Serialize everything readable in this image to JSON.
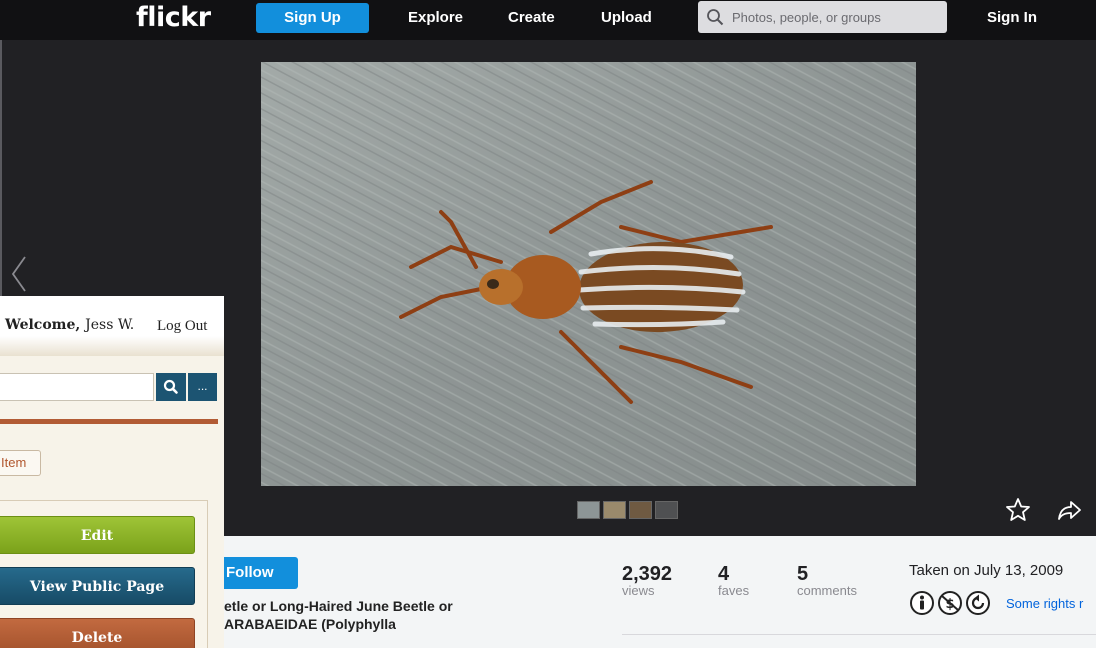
{
  "nav": {
    "logo": "flickr",
    "signup_label": "Sign Up",
    "links": [
      "Explore",
      "Create",
      "Upload"
    ],
    "search_placeholder": "Photos, people, or groups",
    "signin_label": "Sign In"
  },
  "photo": {
    "thumbnail_count": 4,
    "fave_icon": "star-outline-icon",
    "share_icon": "share-arrow-icon"
  },
  "info": {
    "follow_label": "Follow",
    "title_line_1": "etle or Long-Haired June Beetle or",
    "title_line_2": "ARABAEIDAE (Polyphylla",
    "stats": [
      {
        "value": "2,392",
        "label": "views"
      },
      {
        "value": "4",
        "label": "faves"
      },
      {
        "value": "5",
        "label": "comments"
      }
    ],
    "taken": "Taken on July 13, 2009",
    "license_icons": [
      "cc-by-icon",
      "cc-noncommercial-icon",
      "cc-sharealike-icon"
    ],
    "rights_link": "Some rights r"
  },
  "panel": {
    "welcome_prefix": "Welcome,",
    "welcome_user": "Jess W.",
    "logout_label": "Log Out",
    "more_label": "...",
    "new_item_label": "Item",
    "edit_label": "Edit",
    "view_public_label": "View Public Page",
    "delete_label": "Delete"
  },
  "colors": {
    "accent_blue": "#128fdc",
    "panel_green": "#8cb327",
    "panel_navy": "#1c5472",
    "panel_rust": "#b25b34"
  }
}
